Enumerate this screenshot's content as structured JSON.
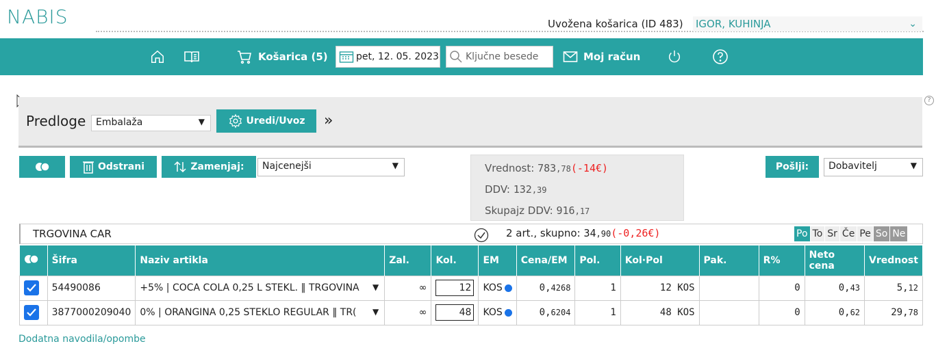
{
  "header": {
    "logo_text": "NABIS",
    "basket_label": "Uvožena košarica (ID 483)",
    "basket_selected": "IGOR, KUHINJA"
  },
  "nav": {
    "cart_label": "Košarica (5)",
    "date_value": "pet, 12. 05. 2023",
    "search_placeholder": "Ključne besede",
    "account_label": "Moj račun"
  },
  "templates": {
    "label": "Predloge",
    "selected": "Embalaža",
    "edit_button": "Uredi/Uvoz",
    "more": "»"
  },
  "toolbar": {
    "remove_button": "Odstrani",
    "replace_button": "Zamenjaj:",
    "replace_option": "Najcenejši",
    "send_label": "Pošlji:",
    "send_option": "Dobavitelj"
  },
  "summary": {
    "value_label": "Vrednost:",
    "value_int": "783",
    "value_dec": ",78",
    "value_diff": "(-14€)",
    "vat_label": "DDV:",
    "vat_int": "132",
    "vat_dec": ",39",
    "total_label": "Skupajz DDV:",
    "total_int": "916",
    "total_dec": ",17"
  },
  "store": {
    "name": "TRGOVINA CAR",
    "total_prefix": "2 art., skupno:",
    "total_int": "34",
    "total_dec": ",90",
    "total_diff": "(-0,26€)",
    "days": [
      "Po",
      "To",
      "Sr",
      "Če",
      "Pe",
      "So",
      "Ne"
    ]
  },
  "table": {
    "headers": [
      "Šifra",
      "Naziv artikla",
      "Zal.",
      "Kol.",
      "EM",
      "Cena/EM",
      "Pol.",
      "Kol·Pol",
      "Pak.",
      "R%",
      "Neto cena",
      "Vrednost"
    ],
    "rows": [
      {
        "code": "54490086",
        "name": "+5%   | COCA COLA 0,25 L STEKL. ‖ TRGOVINA",
        "stock": "∞",
        "qty": "12",
        "unit": "KOS",
        "price_int": "0,",
        "price_dec": "4268",
        "pol": "1",
        "kolpol": "12 KOS",
        "pak": "",
        "r": "0",
        "net_int": "0,",
        "net_dec": "43",
        "value_int": "5,",
        "value_dec": "12"
      },
      {
        "code": "3877000209040",
        "name": "0%   | ORANGINA 0,25 STEKLO REGULAR ‖ TR(",
        "stock": "∞",
        "qty": "48",
        "unit": "KOS",
        "price_int": "0,",
        "price_dec": "6204",
        "pol": "1",
        "kolpol": "48 KOS",
        "pak": "",
        "r": "0",
        "net_int": "0,",
        "net_dec": "62",
        "value_int": "29,",
        "value_dec": "78"
      }
    ]
  },
  "footer": {
    "notes_link": "Dodatna navodila/opombe"
  },
  "colors": {
    "accent": "#28a3a3",
    "checkbox": "#1a73e8",
    "negative": "#e22222"
  }
}
